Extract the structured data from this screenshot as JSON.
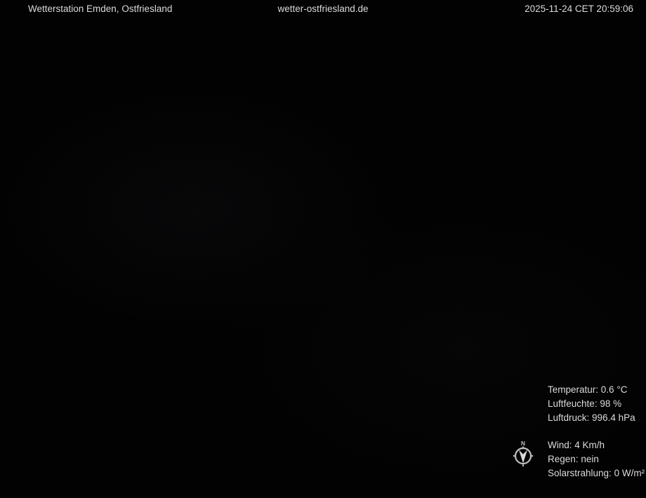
{
  "colors": {
    "background": "#020202",
    "text": "#dcdcdc",
    "compass": "#bfbfbf",
    "compass_bright": "#d8d8d8"
  },
  "header": {
    "station": "Wetterstation Emden, Ostfriesland",
    "website": "wetter-ostfriesland.de",
    "timestamp": "2025-11-24 CET 20:59:06"
  },
  "overlay": {
    "primary_readings": [
      {
        "label": "Temperatur:",
        "value": "0.6 °C"
      },
      {
        "label": "Luftfeuchte:",
        "value": "98 %"
      },
      {
        "label": "Luftdruck:",
        "value": "996.4 hPa"
      }
    ],
    "secondary_readings": [
      {
        "label": "Wind:",
        "value": "4 Km/h"
      },
      {
        "label": "Regen:",
        "value": "nein"
      },
      {
        "label": "Solarstrahlung:",
        "value": "0 W/m²"
      }
    ],
    "compass": {
      "icon": "wind-direction-compass-icon",
      "north_label": "N"
    }
  }
}
